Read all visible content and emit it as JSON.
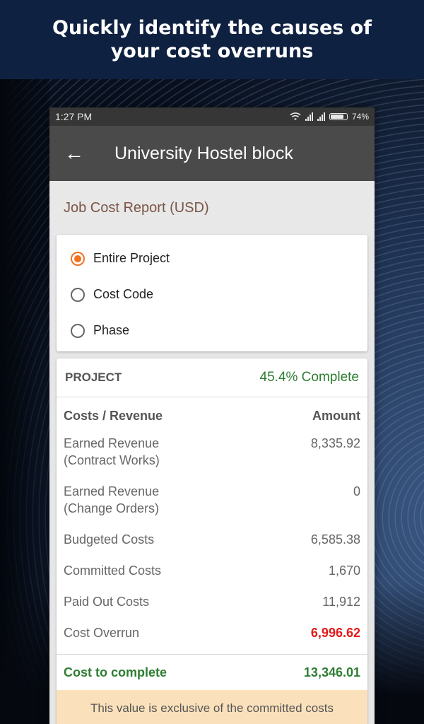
{
  "promo": {
    "title": "Quickly identify the causes of your cost overruns"
  },
  "status_bar": {
    "time": "1:27 PM",
    "battery": "74%",
    "icons": [
      "wifi-icon",
      "signal-icon",
      "signal-icon",
      "battery-icon"
    ]
  },
  "app_bar": {
    "title": "University Hostel block",
    "back_icon": "arrow-left-icon"
  },
  "report": {
    "header": "Job Cost Report (USD)",
    "options": [
      {
        "label": "Entire Project",
        "selected": true
      },
      {
        "label": "Cost Code",
        "selected": false
      },
      {
        "label": "Phase",
        "selected": false
      }
    ],
    "project_label": "PROJECT",
    "complete_text": "45.4% Complete",
    "columns": {
      "left": "Costs / Revenue",
      "right": "Amount"
    },
    "rows": [
      {
        "label": "Earned Revenue (Contract Works)",
        "line1": "Earned Revenue",
        "line2": "(Contract Works)",
        "value": "8,335.92"
      },
      {
        "label": "Earned Revenue (Change Orders)",
        "line1": "Earned Revenue",
        "line2": "(Change Orders)",
        "value": "0"
      },
      {
        "label": "Budgeted Costs",
        "value": "6,585.38"
      },
      {
        "label": "Committed Costs",
        "value": "1,670"
      },
      {
        "label": "Paid Out Costs",
        "value": "11,912"
      },
      {
        "label": "Cost Overrun",
        "value": "6,996.62"
      }
    ],
    "cost_to_complete": {
      "label": "Cost to complete",
      "value": "13,346.01"
    },
    "note": "This value is exclusive of the committed costs"
  },
  "colors": {
    "accent": "#f37021",
    "positive": "#2e7d32",
    "negative": "#e31b1b",
    "header_text": "#7a5546",
    "note_bg": "#fbe1bb"
  }
}
